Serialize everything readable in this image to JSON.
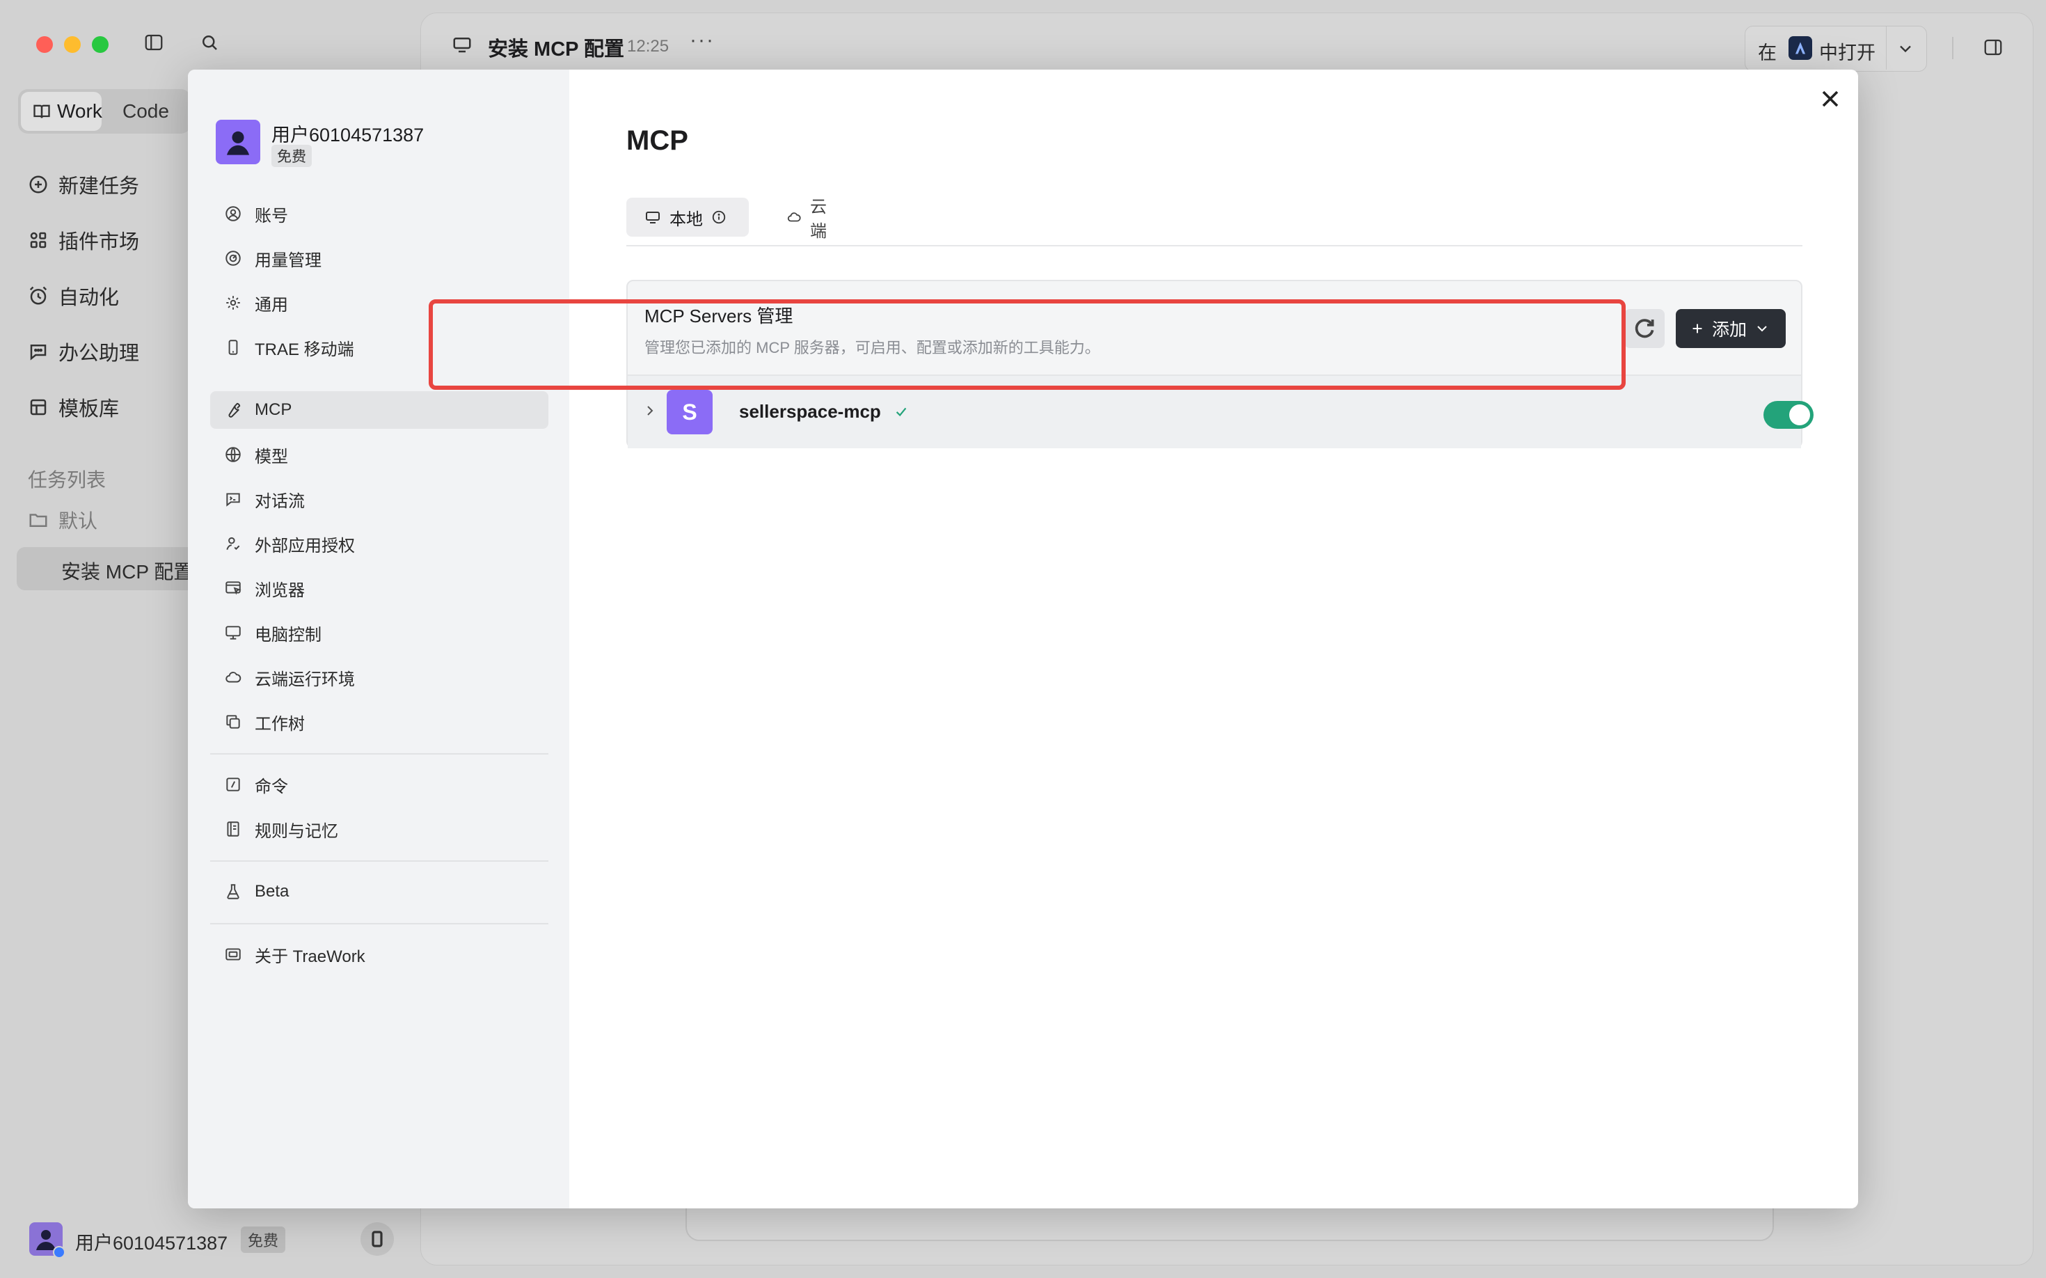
{
  "window": {
    "title": "安装 MCP 配置",
    "time": "12:25",
    "open_in_prefix": "在",
    "open_in_suffix": "中打开"
  },
  "sidebar": {
    "modes": [
      "Work",
      "Code"
    ],
    "nav": [
      "新建任务",
      "插件市场",
      "自动化",
      "办公助理",
      "模板库"
    ],
    "task_list_label": "任务列表",
    "folder_label": "默认",
    "task_item": "安装 MCP 配置",
    "user_name": "用户60104571387",
    "user_badge": "免费"
  },
  "settings": {
    "user_name": "用户60104571387",
    "plan_badge": "免费",
    "menu_group1": [
      "账号",
      "用量管理",
      "通用",
      "TRAE 移动端"
    ],
    "menu_group2": [
      "MCP",
      "模型",
      "对话流",
      "外部应用授权",
      "浏览器",
      "电脑控制",
      "云端运行环境",
      "工作树"
    ],
    "menu_group3": [
      "命令",
      "规则与记忆"
    ],
    "menu_group4": [
      "Beta"
    ],
    "menu_group5": [
      "关于 TraeWork"
    ],
    "active_item": "MCP"
  },
  "mcp": {
    "title": "MCP",
    "tabs": [
      "本地",
      "云端"
    ],
    "active_tab": "本地",
    "panel_title": "MCP Servers 管理",
    "panel_desc": "管理您已添加的 MCP 服务器，可启用、配置或添加新的工具能力。",
    "add_button": "添加",
    "servers": [
      {
        "avatar_letter": "S",
        "name": "sellerspace-mcp",
        "status": "connected",
        "enabled": true
      }
    ]
  },
  "colors": {
    "accent_purple": "#8b6cf6",
    "toggle_on": "#23a37a",
    "highlight_red": "#e84540",
    "dark_button": "#2b2f36"
  }
}
